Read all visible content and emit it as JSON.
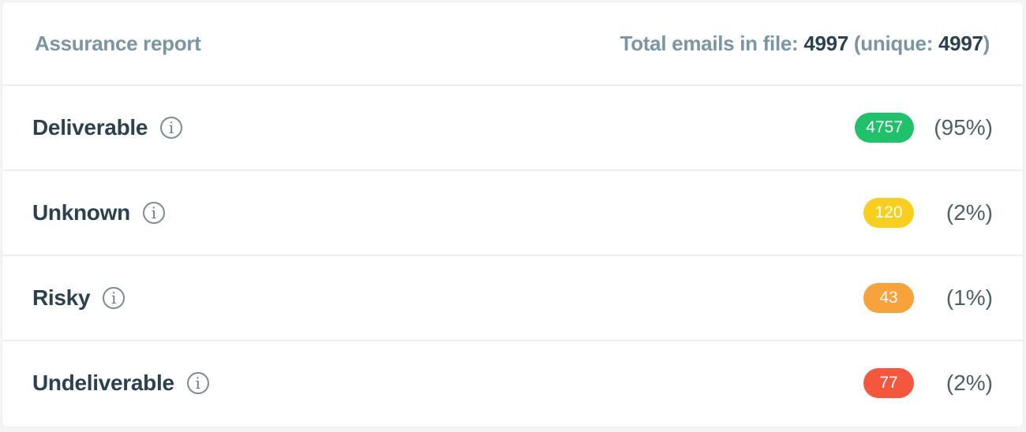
{
  "header": {
    "title": "Assurance report",
    "total_label": "Total emails in file:",
    "total_value": "4997",
    "unique_label": "(unique:",
    "unique_value": "4997",
    "unique_close": ")"
  },
  "rows": [
    {
      "label": "Deliverable",
      "icon": "info-icon",
      "count": "4757",
      "percent": "(95%)",
      "color": "#1fc16b"
    },
    {
      "label": "Unknown",
      "icon": "info-icon",
      "count": "120",
      "percent": "(2%)",
      "color": "#f7d01f"
    },
    {
      "label": "Risky",
      "icon": "info-icon",
      "count": "43",
      "percent": "(1%)",
      "color": "#f7a23a"
    },
    {
      "label": "Undeliverable",
      "icon": "info-icon",
      "count": "77",
      "percent": "(2%)",
      "color": "#f5573e"
    }
  ],
  "info_glyph": "i"
}
